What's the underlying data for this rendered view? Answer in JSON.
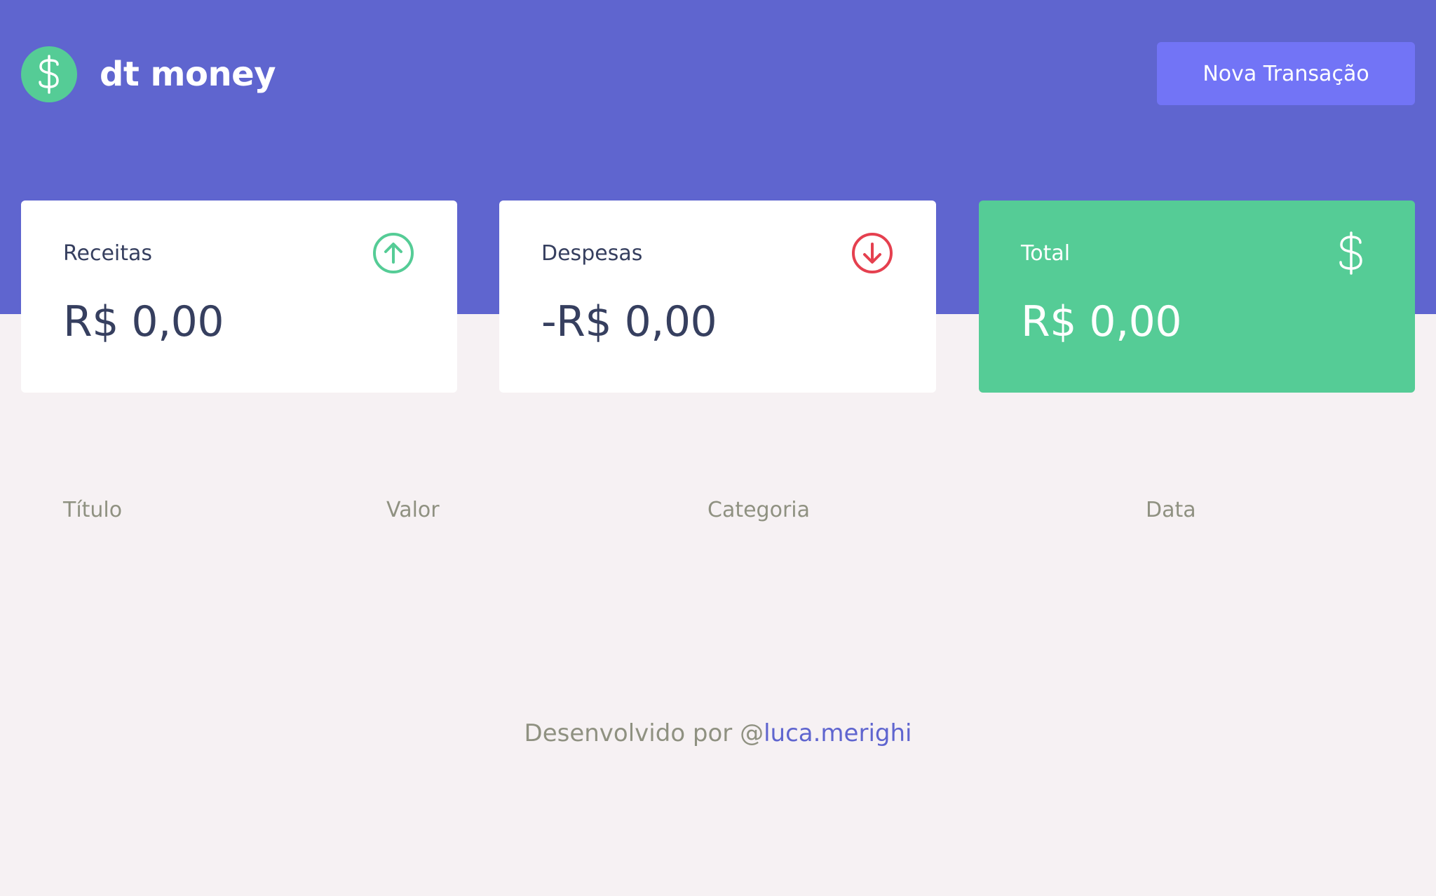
{
  "app": {
    "brand": "dt money",
    "new_transaction_label": "Nova Transação"
  },
  "summary": {
    "income": {
      "label": "Receitas",
      "value": "R$ 0,00",
      "icon": "arrow-up-circle-icon",
      "color": "#55cc96"
    },
    "outcome": {
      "label": "Despesas",
      "value": "-R$ 0,00",
      "icon": "arrow-down-circle-icon",
      "color": "#e5404f"
    },
    "total": {
      "label": "Total",
      "value": "R$ 0,00",
      "icon": "dollar-icon",
      "color": "#ffffff"
    }
  },
  "table": {
    "columns": [
      "Título",
      "Valor",
      "Categoria",
      "Data"
    ],
    "rows": []
  },
  "footer": {
    "prefix": "Desenvolvido por @",
    "link": "luca.merighi"
  },
  "colors": {
    "header_bg": "#5f65cf",
    "accent_green": "#55cc96",
    "button_bg": "#7274f6",
    "page_bg": "#f6f1f3",
    "text_dark": "#363f5f",
    "text_muted": "#8f9181"
  }
}
